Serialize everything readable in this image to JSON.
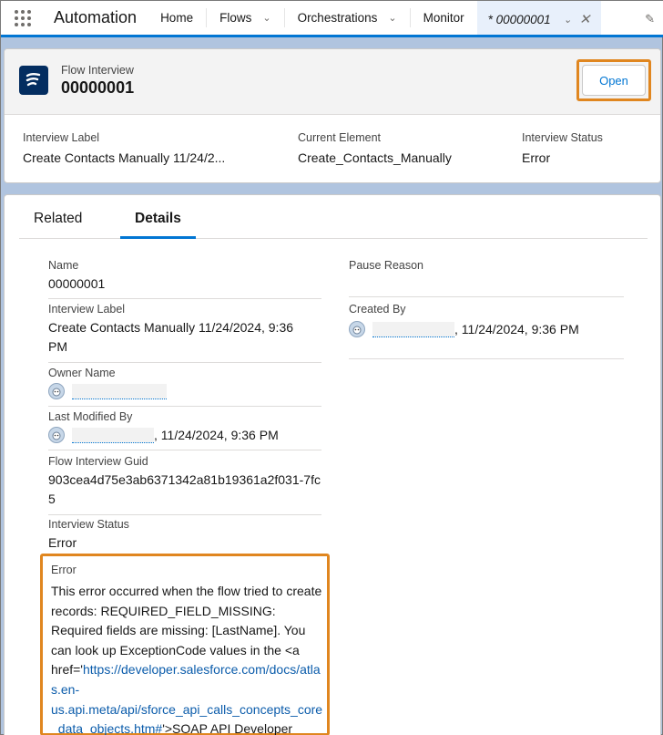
{
  "nav": {
    "app_name": "Automation",
    "items": [
      {
        "label": "Home",
        "has_menu": false
      },
      {
        "label": "Flows",
        "has_menu": true
      },
      {
        "label": "Orchestrations",
        "has_menu": true
      },
      {
        "label": "Monitor",
        "has_menu": false
      }
    ],
    "active_tab": "* 00000001"
  },
  "header": {
    "object_type": "Flow Interview",
    "record_name": "00000001",
    "open_label": "Open",
    "highlights": [
      {
        "label": "Interview Label",
        "value": "Create Contacts Manually 11/24/2..."
      },
      {
        "label": "Current Element",
        "value": "Create_Contacts_Manually"
      },
      {
        "label": "Interview Status",
        "value": "Error"
      }
    ]
  },
  "tabs": {
    "related": "Related",
    "details": "Details"
  },
  "details": {
    "name_label": "Name",
    "name_value": "00000001",
    "pause_reason_label": "Pause Reason",
    "interview_label_label": "Interview Label",
    "interview_label_value": "Create Contacts Manually 11/24/2024, 9:36 PM",
    "created_by_label": "Created By",
    "created_by_date": ", 11/24/2024, 9:36 PM",
    "owner_name_label": "Owner Name",
    "last_modified_label": "Last Modified By",
    "last_modified_date": ", 11/24/2024, 9:36 PM",
    "guid_label": "Flow Interview Guid",
    "guid_value": "903cea4d75e3ab6371342a81b19361a2f031-7fc5",
    "status_label": "Interview Status",
    "status_value": "Error",
    "error_label": "Error",
    "error_text_before": "This error occurred when the flow tried to create records: REQUIRED_FIELD_MISSING: Required fields are missing: [LastName]. You can look up ExceptionCode values in the <a href='",
    "error_link": "https://developer.salesforce.com/docs/atlas.en-us.api.meta/api/sforce_api_calls_concepts_core_data_objects.htm#",
    "error_text_after": "'>SOAP API Developer"
  },
  "colors": {
    "brand_blue": "#0176d3",
    "highlight_orange": "#e0861f",
    "background": "#b0c4df"
  }
}
